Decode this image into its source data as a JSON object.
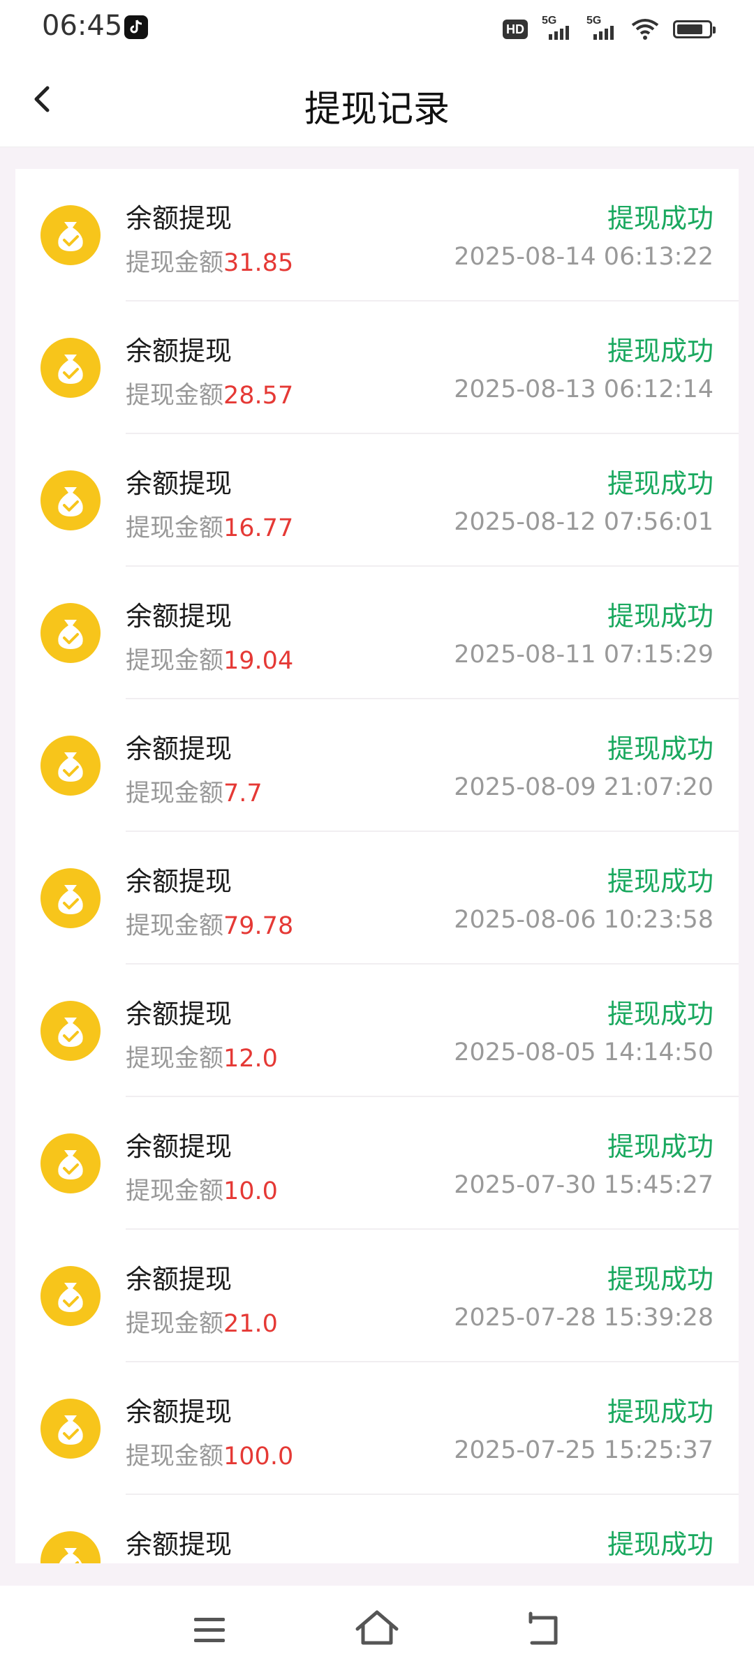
{
  "status_bar": {
    "time": "06:45",
    "hd": "HD",
    "signal1": "5G",
    "signal2": "5G"
  },
  "header": {
    "title": "提现记录"
  },
  "colors": {
    "status_success": "#19a85e",
    "amount": "#e53935",
    "icon_yellow": "#f7c51b"
  },
  "records": [
    {
      "title": "余额提现",
      "amount_label": "提现金额",
      "amount": "31.85",
      "status": "提现成功",
      "time": "2025-08-14 06:13:22"
    },
    {
      "title": "余额提现",
      "amount_label": "提现金额",
      "amount": "28.57",
      "status": "提现成功",
      "time": "2025-08-13 06:12:14"
    },
    {
      "title": "余额提现",
      "amount_label": "提现金额",
      "amount": "16.77",
      "status": "提现成功",
      "time": "2025-08-12 07:56:01"
    },
    {
      "title": "余额提现",
      "amount_label": "提现金额",
      "amount": "19.04",
      "status": "提现成功",
      "time": "2025-08-11 07:15:29"
    },
    {
      "title": "余额提现",
      "amount_label": "提现金额",
      "amount": "7.7",
      "status": "提现成功",
      "time": "2025-08-09 21:07:20"
    },
    {
      "title": "余额提现",
      "amount_label": "提现金额",
      "amount": "79.78",
      "status": "提现成功",
      "time": "2025-08-06 10:23:58"
    },
    {
      "title": "余额提现",
      "amount_label": "提现金额",
      "amount": "12.0",
      "status": "提现成功",
      "time": "2025-08-05 14:14:50"
    },
    {
      "title": "余额提现",
      "amount_label": "提现金额",
      "amount": "10.0",
      "status": "提现成功",
      "time": "2025-07-30 15:45:27"
    },
    {
      "title": "余额提现",
      "amount_label": "提现金额",
      "amount": "21.0",
      "status": "提现成功",
      "time": "2025-07-28 15:39:28"
    },
    {
      "title": "余额提现",
      "amount_label": "提现金额",
      "amount": "100.0",
      "status": "提现成功",
      "time": "2025-07-25 15:25:37"
    },
    {
      "title": "余额提现",
      "amount_label": "",
      "amount": "",
      "status": "提现成功",
      "time": ""
    }
  ],
  "icons": {
    "back": "back-arrow-icon",
    "record": "money-bag-icon",
    "nav_menu": "menu-icon",
    "nav_home": "home-icon",
    "nav_back": "back-icon"
  }
}
